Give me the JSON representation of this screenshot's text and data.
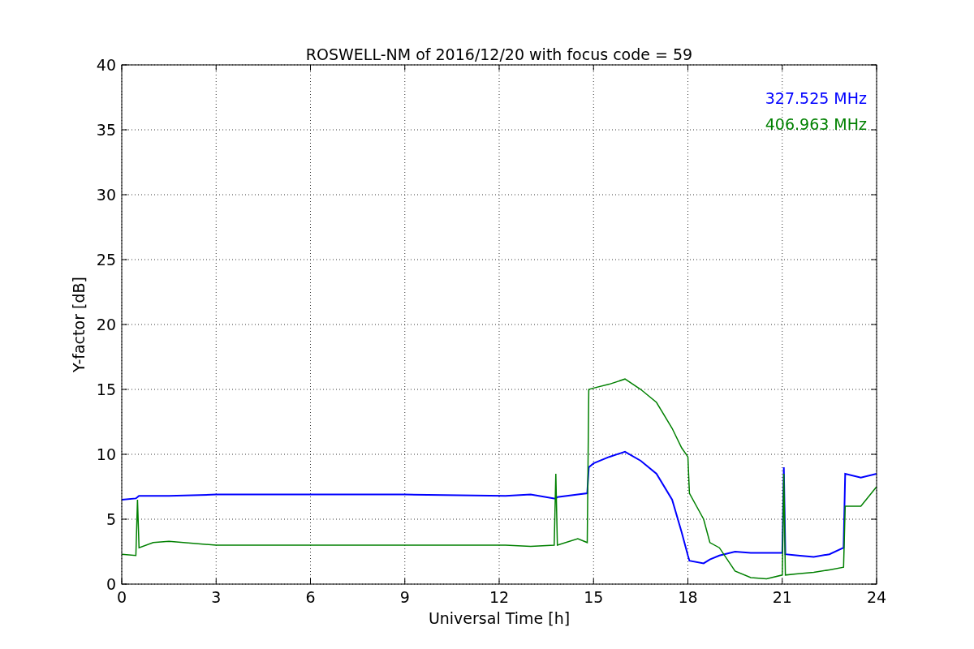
{
  "chart_data": {
    "type": "line",
    "title": "ROSWELL-NM of 2016/12/20 with focus code = 59",
    "xlabel": "Universal Time [h]",
    "ylabel": "Y-factor [dB]",
    "xlim": [
      0,
      24
    ],
    "ylim": [
      0,
      40
    ],
    "xticks": [
      0,
      3,
      6,
      9,
      12,
      15,
      18,
      21,
      24
    ],
    "yticks": [
      0,
      5,
      10,
      15,
      20,
      25,
      30,
      35,
      40
    ],
    "grid": true,
    "x": [
      0,
      0.45,
      0.5,
      0.55,
      1,
      1.5,
      3,
      6,
      9,
      12.2,
      13,
      13.75,
      13.8,
      13.85,
      14.5,
      14.8,
      14.85,
      15,
      15.5,
      16,
      16.5,
      17,
      17.5,
      17.8,
      18,
      18.05,
      18.5,
      18.7,
      19,
      19.5,
      20,
      20.5,
      21,
      21.05,
      21.1,
      21.5,
      22,
      22.5,
      22.95,
      23,
      23.5,
      24
    ],
    "series": [
      {
        "name": "327.525 MHz",
        "color": "#0000ff",
        "values": [
          6.5,
          6.6,
          6.7,
          6.8,
          6.8,
          6.8,
          6.9,
          6.9,
          6.9,
          6.8,
          6.9,
          6.6,
          6.6,
          6.7,
          6.9,
          7.0,
          9.0,
          9.3,
          9.8,
          10.2,
          9.5,
          8.5,
          6.5,
          4.0,
          2.2,
          1.8,
          1.6,
          1.9,
          2.2,
          2.5,
          2.4,
          2.4,
          2.4,
          9.0,
          2.3,
          2.2,
          2.1,
          2.3,
          2.8,
          8.5,
          8.2,
          8.5
        ]
      },
      {
        "name": "406.963 MHz",
        "color": "#008000",
        "values": [
          2.3,
          2.2,
          6.5,
          2.8,
          3.2,
          3.3,
          3.0,
          3.0,
          3.0,
          3.0,
          2.9,
          3.0,
          8.5,
          3.0,
          3.5,
          3.2,
          15.0,
          15.1,
          15.4,
          15.8,
          15.0,
          14.0,
          12.0,
          10.5,
          9.8,
          7.0,
          5.0,
          3.2,
          2.8,
          1.0,
          0.5,
          0.4,
          0.7,
          8.5,
          0.7,
          0.8,
          0.9,
          1.1,
          1.3,
          6.0,
          6.0,
          7.5
        ]
      }
    ]
  }
}
